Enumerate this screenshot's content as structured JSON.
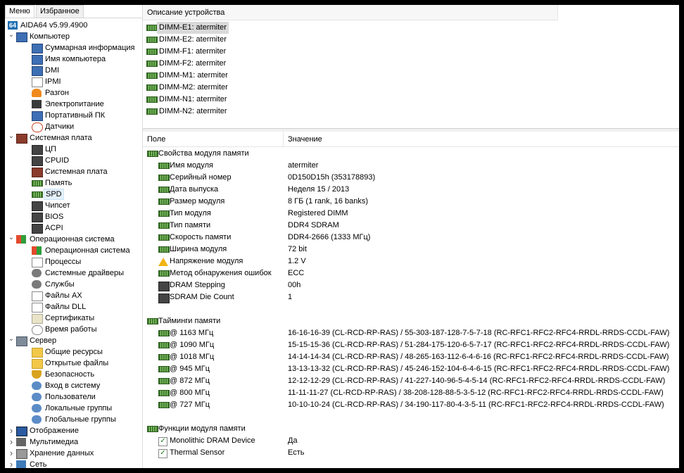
{
  "left_tabs": [
    "Меню",
    "Избранное"
  ],
  "tree": {
    "root": "AIDA64 v5.99.4900",
    "computer": {
      "label": "Компьютер",
      "items": [
        "Суммарная информация",
        "Имя компьютера",
        "DMI",
        "IPMI",
        "Разгон",
        "Электропитание",
        "Портативный ПК",
        "Датчики"
      ]
    },
    "motherboard": {
      "label": "Системная плата",
      "items": [
        "ЦП",
        "CPUID",
        "Системная плата",
        "Память",
        "SPD",
        "Чипсет",
        "BIOS",
        "ACPI"
      ]
    },
    "os": {
      "label": "Операционная система",
      "items": [
        "Операционная система",
        "Процессы",
        "Системные драйверы",
        "Службы",
        "Файлы AX",
        "Файлы DLL",
        "Сертификаты",
        "Время работы"
      ]
    },
    "server": {
      "label": "Сервер",
      "items": [
        "Общие ресурсы",
        "Открытые файлы",
        "Безопасность",
        "Вход в систему",
        "Пользователи",
        "Локальные группы",
        "Глобальные группы"
      ]
    },
    "collapsed": [
      "Отображение",
      "Мультимедиа",
      "Хранение данных",
      "Сеть"
    ]
  },
  "device_header": "Описание устройства",
  "devices": [
    "DIMM-E1: atermiter",
    "DIMM-E2: atermiter",
    "DIMM-F1: atermiter",
    "DIMM-F2: atermiter",
    "DIMM-M1: atermiter",
    "DIMM-M2: atermiter",
    "DIMM-N1: atermiter",
    "DIMM-N2: atermiter"
  ],
  "columns": {
    "field": "Поле",
    "value": "Значение"
  },
  "sections": {
    "props": {
      "title": "Свойства модуля памяти",
      "rows": [
        {
          "field": "Имя модуля",
          "value": "atermiter",
          "icon": "memory-icon"
        },
        {
          "field": "Серийный номер",
          "value": "0D150D15h (353178893)",
          "icon": "memory-icon"
        },
        {
          "field": "Дата выпуска",
          "value": "Неделя 15 / 2013",
          "icon": "memory-icon"
        },
        {
          "field": "Размер модуля",
          "value": "8 ГБ (1 rank, 16 banks)",
          "icon": "memory-icon"
        },
        {
          "field": "Тип модуля",
          "value": "Registered DIMM",
          "icon": "memory-icon"
        },
        {
          "field": "Тип памяти",
          "value": "DDR4 SDRAM",
          "icon": "memory-icon"
        },
        {
          "field": "Скорость памяти",
          "value": "DDR4-2666 (1333 МГц)",
          "icon": "memory-icon"
        },
        {
          "field": "Ширина модуля",
          "value": "72 bit",
          "icon": "memory-icon"
        },
        {
          "field": "Напряжение модуля",
          "value": "1.2 V",
          "icon": "warning-icon"
        },
        {
          "field": "Метод обнаружения ошибок",
          "value": "ECC",
          "icon": "memory-icon"
        },
        {
          "field": "DRAM Stepping",
          "value": "00h",
          "icon": "chip-icon"
        },
        {
          "field": "SDRAM Die Count",
          "value": "1",
          "icon": "chip-icon"
        }
      ]
    },
    "timings": {
      "title": "Тайминги памяти",
      "rows": [
        {
          "field": "@ 1163 МГц",
          "value": "16-16-16-39  (CL-RCD-RP-RAS) / 55-303-187-128-7-5-7-18  (RC-RFC1-RFC2-RFC4-RRDL-RRDS-CCDL-FAW)"
        },
        {
          "field": "@ 1090 МГц",
          "value": "15-15-15-36  (CL-RCD-RP-RAS) / 51-284-175-120-6-5-7-17  (RC-RFC1-RFC2-RFC4-RRDL-RRDS-CCDL-FAW)"
        },
        {
          "field": "@ 1018 МГц",
          "value": "14-14-14-34  (CL-RCD-RP-RAS) / 48-265-163-112-6-4-6-16  (RC-RFC1-RFC2-RFC4-RRDL-RRDS-CCDL-FAW)"
        },
        {
          "field": "@ 945 МГц",
          "value": "13-13-13-32  (CL-RCD-RP-RAS) / 45-246-152-104-6-4-6-15  (RC-RFC1-RFC2-RFC4-RRDL-RRDS-CCDL-FAW)"
        },
        {
          "field": "@ 872 МГц",
          "value": "12-12-12-29  (CL-RCD-RP-RAS) / 41-227-140-96-5-4-5-14  (RC-RFC1-RFC2-RFC4-RRDL-RRDS-CCDL-FAW)"
        },
        {
          "field": "@ 800 МГц",
          "value": "11-11-11-27  (CL-RCD-RP-RAS) / 38-208-128-88-5-3-5-12  (RC-RFC1-RFC2-RFC4-RRDL-RRDS-CCDL-FAW)"
        },
        {
          "field": "@ 727 МГц",
          "value": "10-10-10-24  (CL-RCD-RP-RAS) / 34-190-117-80-4-3-5-11  (RC-RFC1-RFC2-RFC4-RRDL-RRDS-CCDL-FAW)"
        }
      ]
    },
    "features": {
      "title": "Функции модуля памяти",
      "rows": [
        {
          "field": "Monolithic DRAM Device",
          "value": "Да"
        },
        {
          "field": "Thermal Sensor",
          "value": "Есть"
        }
      ]
    }
  }
}
